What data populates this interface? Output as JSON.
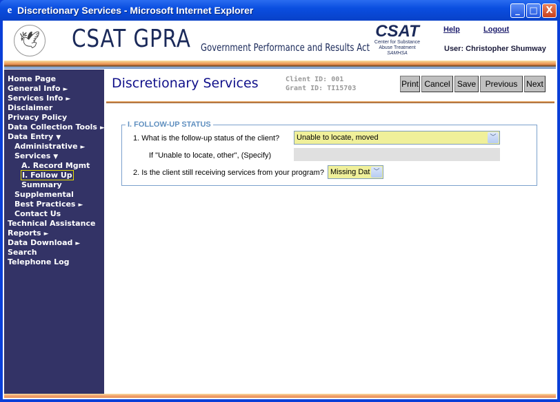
{
  "window": {
    "title": "Discretionary Services - Microsoft Internet Explorer",
    "minimize": "_",
    "maximize": "□",
    "close": "X"
  },
  "header": {
    "logo_text": "CSAT GPRA",
    "logo_subtitle": "Government Performance and Results Act",
    "csat_logo": {
      "name": "CSAT",
      "line1": "Center for Substance",
      "line2": "Abuse Treatment",
      "line3": "SAMHSA"
    },
    "help": "Help",
    "logout": "Logout",
    "user": "User: Christopher Shumway"
  },
  "sidebar": {
    "items": [
      {
        "label": "Home Page",
        "level": 1,
        "arrow": ""
      },
      {
        "label": "General Info",
        "level": 1,
        "arrow": "►"
      },
      {
        "label": "Services Info",
        "level": 1,
        "arrow": "►"
      },
      {
        "label": "Disclaimer",
        "level": 1,
        "arrow": ""
      },
      {
        "label": "Privacy Policy",
        "level": 1,
        "arrow": ""
      },
      {
        "label": "Data Collection Tools",
        "level": 1,
        "arrow": "►"
      },
      {
        "label": "Data Entry",
        "level": 1,
        "arrow": "▼"
      },
      {
        "label": "Administrative",
        "level": 2,
        "arrow": "►"
      },
      {
        "label": "Services",
        "level": 2,
        "arrow": "▼"
      },
      {
        "label": "A. Record Mgmt",
        "level": 3,
        "arrow": ""
      },
      {
        "label": "I. Follow Up",
        "level": 3,
        "arrow": "",
        "selected": true
      },
      {
        "label": "Summary",
        "level": 3,
        "arrow": ""
      },
      {
        "label": "Supplemental",
        "level": 2,
        "arrow": ""
      },
      {
        "label": "Best Practices",
        "level": 2,
        "arrow": "►"
      },
      {
        "label": "Contact Us",
        "level": 2,
        "arrow": ""
      },
      {
        "label": "Technical Assistance",
        "level": 1,
        "arrow": ""
      },
      {
        "label": "Reports",
        "level": 1,
        "arrow": "►"
      },
      {
        "label": "Data Download",
        "level": 1,
        "arrow": "►"
      },
      {
        "label": "Search",
        "level": 1,
        "arrow": ""
      },
      {
        "label": "Telephone Log",
        "level": 1,
        "arrow": ""
      }
    ]
  },
  "main": {
    "title": "Discretionary Services",
    "client_id": "Client ID: 001",
    "grant_id": "Grant ID: TI15703",
    "buttons": {
      "print": "Print",
      "cancel": "Cancel",
      "save": "Save",
      "previous": "Previous",
      "next": "Next"
    },
    "section": {
      "legend": "I. FOLLOW-UP STATUS",
      "q1": {
        "label": "1. What is the follow-up status of the client?",
        "value": "Unable to locate, moved"
      },
      "q1_specify": {
        "label": "If \"Unable to locate, other\", (Specify)",
        "value": ""
      },
      "q2": {
        "label": "2. Is the client still receiving services from your program?",
        "value": "Missing Dat"
      }
    }
  }
}
